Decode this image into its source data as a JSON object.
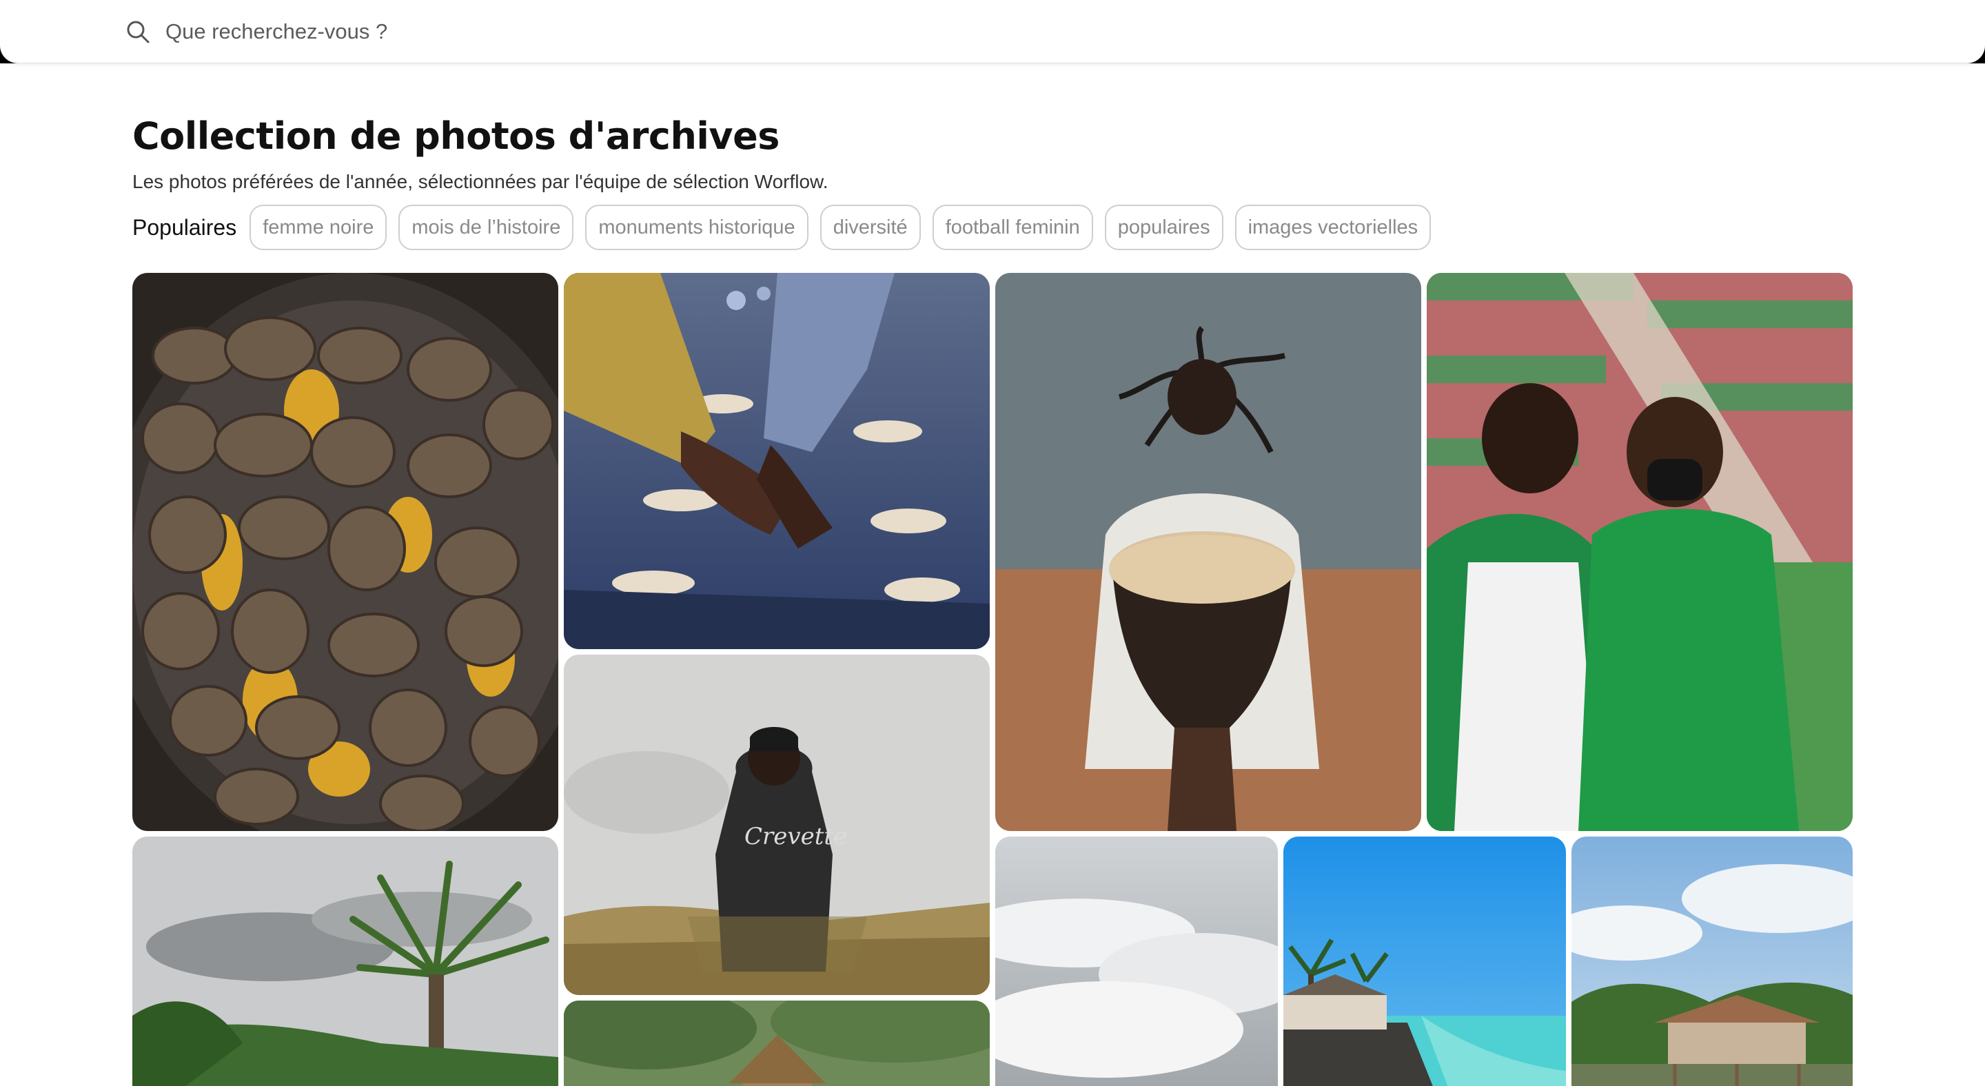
{
  "search": {
    "placeholder": "Que recherchez-vous ?",
    "icon": "search-icon"
  },
  "collection": {
    "title": "Collection de photos d'archives",
    "subtitle": "Les photos préférées de l'année, sélectionnées par l'équipe de sélection Worflow."
  },
  "popular": {
    "label": "Populaires",
    "tags": [
      "femme noire",
      "mois de l’histoire",
      "monuments historique",
      "diversité",
      "football feminin",
      "populaires",
      "images vectorielles"
    ]
  },
  "photos": [
    {
      "subject": "roasted potatoes and corn in pan"
    },
    {
      "subject": "handshake at event with decorations"
    },
    {
      "subject": "man with dreadlocks playing djembe"
    },
    {
      "subject": "two football players talking in stadium"
    },
    {
      "subject": "palm trees under cloudy sky"
    },
    {
      "subject": "man in hoodie walking in fog",
      "shirt_text": "Crevette"
    },
    {
      "subject": "thatched hut among trees"
    },
    {
      "subject": "clouds above mountain"
    },
    {
      "subject": "tropical beach with palm trees"
    },
    {
      "subject": "wooden pavilion on water with palms"
    }
  ],
  "colors": {
    "accent_text": "#111111",
    "tag_border": "#cfcfcf",
    "tag_text": "#8a8a8a"
  }
}
